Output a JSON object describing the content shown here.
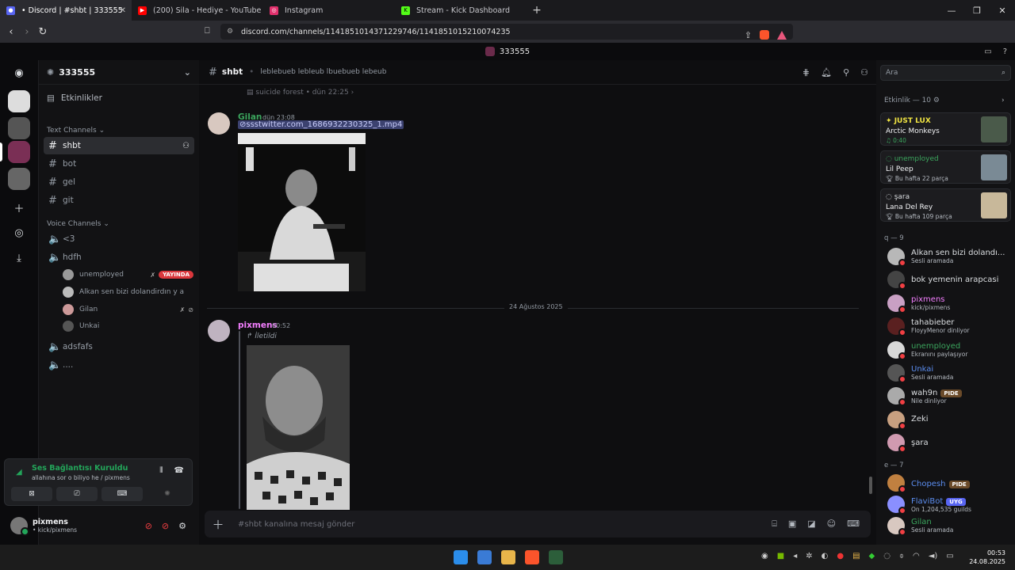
{
  "browser": {
    "tabs": [
      {
        "label": "• Discord | #shbt | 333555",
        "active": true,
        "color": "#5865f2"
      },
      {
        "label": "(200) Sila - Hediye - YouTube",
        "active": false,
        "color": "#ff0000"
      },
      {
        "label": "Instagram",
        "active": false,
        "color": "#e1306c"
      },
      {
        "label": "Stream - Kick Dashboard",
        "active": false,
        "color": "#53fc18"
      }
    ],
    "url": "discord.com/channels/1141851014371229746/1141851015210074235"
  },
  "window": {
    "server_title": "333555"
  },
  "server": {
    "name": "333555",
    "events_label": "Etkinlikler",
    "text_category": "Text Channels",
    "text_channels": [
      "shbt",
      "bot",
      "gel",
      "git"
    ],
    "voice_category": "Voice Channels",
    "voice_channels": [
      "<3",
      "hdfh",
      "adsfafs",
      "...."
    ],
    "voice_users": [
      {
        "name": "unemployed",
        "live_label": "YAYINDA"
      },
      {
        "name": "Alkan sen bizi dolandirdın y a"
      },
      {
        "name": "Gilan"
      },
      {
        "name": "Unkai"
      }
    ]
  },
  "voice_panel": {
    "title": "Ses Bağlantısı Kuruldu",
    "subtitle": "allahına sor o biliyo he / pixmens"
  },
  "user": {
    "name": "pixmens",
    "status": "• kick/pixmens"
  },
  "channel": {
    "name": "shbt",
    "topic": "leblebueb lebleub lbuebueb lebeub"
  },
  "messages": {
    "forward_ref": "suicide forest  •  dün 22:25",
    "m1": {
      "author": "Gilan",
      "time": "dün 23:08",
      "link": "ssstwitter.com_1686932230325_1.mp4"
    },
    "date_divider": "24 Ağustos 2025",
    "m2": {
      "author": "pixmens",
      "time": "00:52",
      "forwarded_label": "İletildi"
    }
  },
  "composer": {
    "placeholder": "#shbt kanalına mesaj gönder"
  },
  "search": {
    "placeholder": "Ara"
  },
  "activity": {
    "header": "Etkinlik — 10",
    "cards": [
      {
        "user": "JUST LUX",
        "title": "Arctic Monkeys",
        "detail": "0:40",
        "user_color": "#f0e442"
      },
      {
        "user": "unemployed",
        "title": "Lil Peep",
        "detail": "Bu hafta 22 parça",
        "user_color": "#3ba55d"
      },
      {
        "user": "şara",
        "title": "Lana Del Rey",
        "detail": "Bu hafta 109 parça",
        "user_color": "#dbdee1"
      }
    ]
  },
  "members": {
    "group1": "q — 9",
    "group1_list": [
      {
        "name": "Alkan sen bizi dolandı...",
        "status": "Sesli aramada",
        "color": "#dbdee1"
      },
      {
        "name": "bok yemenin arapcasi",
        "status": "",
        "color": "#dbdee1"
      },
      {
        "name": "pixmens",
        "status": "kick/pixmens",
        "color": "#f47fff"
      },
      {
        "name": "tahabieber",
        "status": "FloyyMenor dinliyor",
        "color": "#dbdee1"
      },
      {
        "name": "unemployed",
        "status": "Ekranını paylaşıyor",
        "color": "#3ba55d"
      },
      {
        "name": "Unkai",
        "status": "Sesli aramada",
        "color": "#5b8def"
      },
      {
        "name": "wah9n",
        "status": "Nile dinliyor",
        "color": "#dbdee1",
        "badge": "PIDE"
      },
      {
        "name": "Zeki",
        "status": "",
        "color": "#dbdee1"
      },
      {
        "name": "şara",
        "status": "",
        "color": "#dbdee1"
      }
    ],
    "group2": "e — 7",
    "group2_list": [
      {
        "name": "Chopesh",
        "status": "",
        "color": "#5b8def",
        "badge": "PIDE"
      },
      {
        "name": "FlaviBot",
        "status": "On 1,204,535 guilds",
        "color": "#5b8def",
        "badge": "UYG"
      },
      {
        "name": "Gilan",
        "status": "Sesli aramada",
        "color": "#3ba55d"
      }
    ]
  },
  "taskbar": {
    "time": "00:53",
    "date": "24.08.2025"
  }
}
